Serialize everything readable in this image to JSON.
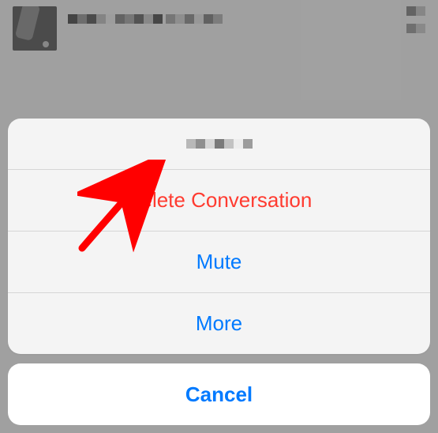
{
  "sheet": {
    "delete_label": "Delete Conversation",
    "mute_label": "Mute",
    "more_label": "More",
    "cancel_label": "Cancel"
  },
  "colors": {
    "destructive": "#ff3b30",
    "accent": "#007aff"
  }
}
